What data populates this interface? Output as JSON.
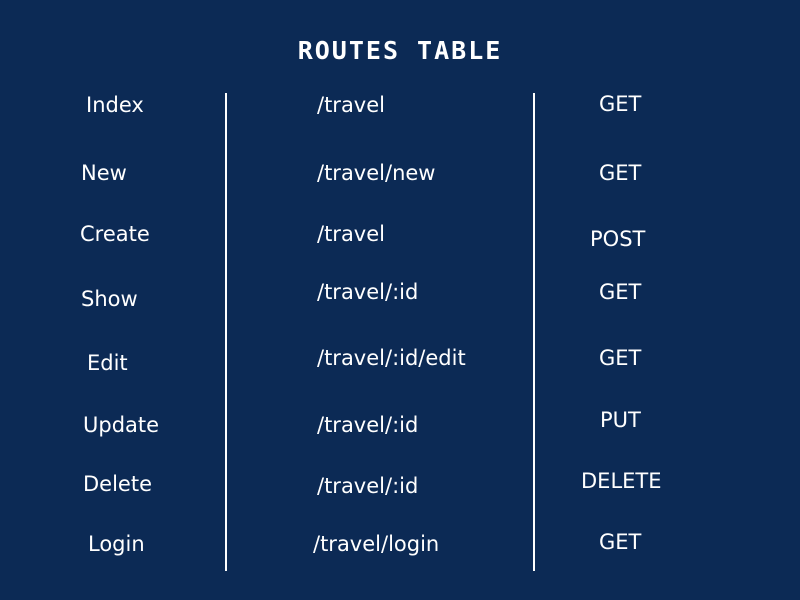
{
  "title": "ROUTES TABLE",
  "colors": {
    "background": "#0c2a55",
    "text": "#ffffff",
    "divider": "#ffffff"
  },
  "rows": [
    {
      "action": "Index",
      "path": "/travel",
      "method": "GET"
    },
    {
      "action": "New",
      "path": "/travel/new",
      "method": "GET"
    },
    {
      "action": "Create",
      "path": "/travel",
      "method": "POST"
    },
    {
      "action": "Show",
      "path": "/travel/:id",
      "method": "GET"
    },
    {
      "action": "Edit",
      "path": "/travel/:id/edit",
      "method": "GET"
    },
    {
      "action": "Update",
      "path": "/travel/:id",
      "method": "PUT"
    },
    {
      "action": "Delete",
      "path": "/travel/:id",
      "method": "DELETE"
    },
    {
      "action": "Login",
      "path": "/travel/login",
      "method": "GET"
    }
  ]
}
